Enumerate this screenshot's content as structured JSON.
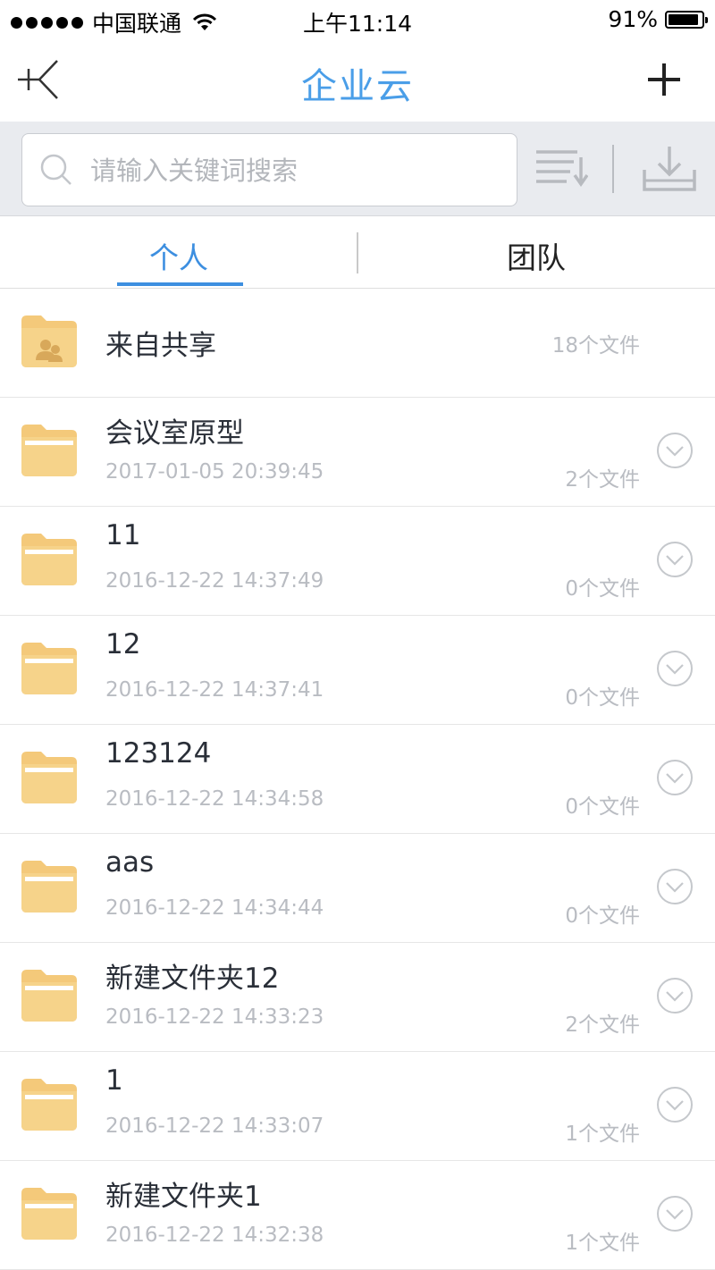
{
  "status_bar": {
    "carrier": "中国联通",
    "time": "上午11:14",
    "battery": "91%",
    "battery_level": 0.91
  },
  "nav": {
    "title": "企业云",
    "back_icon": "back-icon",
    "add_icon": "plus-icon"
  },
  "search": {
    "placeholder": "请输入关键词搜索",
    "value": ""
  },
  "tabs": [
    {
      "label": "个人",
      "active": true
    },
    {
      "label": "团队",
      "active": false
    }
  ],
  "colors": {
    "accent": "#3d8fe0",
    "folder": "#f4c97a",
    "muted_text": "#b9bcc2"
  },
  "files": [
    {
      "name": "来自共享",
      "date": "",
      "count": "18个文件",
      "type": "shared-folder"
    },
    {
      "name": "会议室原型",
      "date": "2017-01-05 20:39:45",
      "count": "2个文件",
      "type": "folder"
    },
    {
      "name": "11",
      "date": "2016-12-22 14:37:49",
      "count": "0个文件",
      "type": "folder"
    },
    {
      "name": "12",
      "date": "2016-12-22 14:37:41",
      "count": "0个文件",
      "type": "folder"
    },
    {
      "name": "123124",
      "date": "2016-12-22 14:34:58",
      "count": "0个文件",
      "type": "folder"
    },
    {
      "name": "aas",
      "date": "2016-12-22 14:34:44",
      "count": "0个文件",
      "type": "folder"
    },
    {
      "name": "新建文件夹12",
      "date": "2016-12-22 14:33:23",
      "count": "2个文件",
      "type": "folder"
    },
    {
      "name": "1",
      "date": "2016-12-22 14:33:07",
      "count": "1个文件",
      "type": "folder"
    },
    {
      "name": "新建文件夹1",
      "date": "2016-12-22 14:32:38",
      "count": "1个文件",
      "type": "folder"
    }
  ]
}
